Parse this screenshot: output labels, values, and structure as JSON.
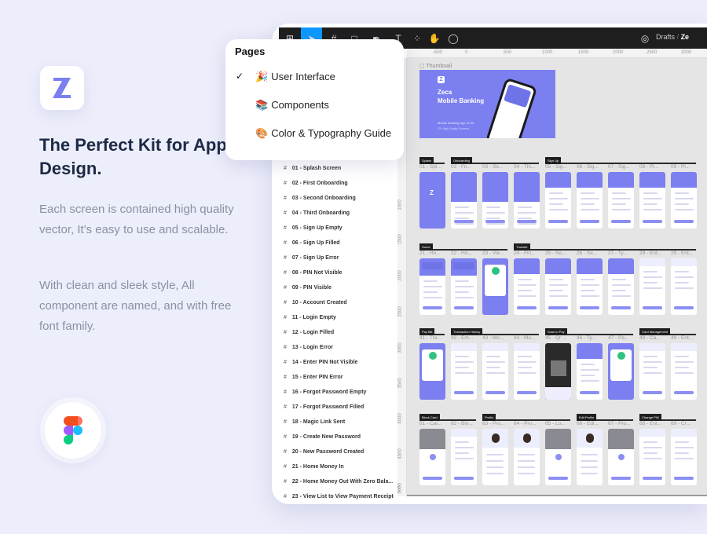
{
  "brand": {
    "accent": "#7b7ff0",
    "logo_letter": "Z"
  },
  "hero": {
    "title": "The Perfect Kit for App Design.",
    "paragraph1": "Each screen is contained high quality vector, It's easy to use and scalable.",
    "paragraph2": "With clean and sleek style, All component are named, and with free font family."
  },
  "toolbar": {
    "breadcrumb_root": "Drafts",
    "breadcrumb_sep": "/",
    "breadcrumb_file": "Ze",
    "active_tool": "move"
  },
  "pages_menu": {
    "title": "Pages",
    "items": [
      {
        "emoji": "🎉",
        "label": "User Interface",
        "selected": true
      },
      {
        "emoji": "📚",
        "label": "Components",
        "selected": false
      },
      {
        "emoji": "🎨",
        "label": "Color & Typography Guide",
        "selected": false
      }
    ]
  },
  "rulers": {
    "horizontal": [
      "-500",
      "0",
      "500",
      "1000",
      "1500",
      "2000",
      "2500",
      "3000"
    ],
    "vertical": [
      "1000",
      "1500",
      "2000",
      "2500",
      "3000",
      "3500",
      "4000",
      "4500",
      "5000",
      "100"
    ]
  },
  "layers": [
    "01 - Splash Screen",
    "02 - First Onboarding",
    "03 - Second Onboarding",
    "04 - Third Onboarding",
    "05 - Sign Up Empty",
    "06 - Sign Up Filled",
    "07 - Sign Up Error",
    "08 - PIN Not Visible",
    "09 - PIN Visible",
    "10 - Account Created",
    "11 - Login Empty",
    "12 - Login Filled",
    "13 - Login Error",
    "14 - Enter PIN Not Visible",
    "15 - Enter PIN Error",
    "16 - Forgot Password Empty",
    "17 - Forgot Password Filled",
    "18 - Magic Link Sent",
    "19 - Create New Password",
    "20 - New Password Created",
    "21 - Home Money In",
    "22 - Home Money Out With Zero Bala...",
    "23 - View List to View Payment Receipt"
  ],
  "thumbnail": {
    "label": "Thumbnail",
    "title_line1": "Zeca",
    "title_line2": "Mobile Banking",
    "subtitle": "Mobile Banking App UI Kit",
    "caption": "70+ High Quality Screens"
  },
  "canvas_rows": [
    {
      "sections": [
        {
          "col": 0,
          "span": 1,
          "label": "Splash"
        },
        {
          "col": 1,
          "span": 3,
          "label": "Onboarding"
        },
        {
          "col": 4,
          "span": 5,
          "label": "Sign Up"
        }
      ],
      "frames": [
        "01 - Spl...",
        "02 - Fir...",
        "03 - Se...",
        "04 - Thi...",
        "05 - Sig...",
        "06 - Sig...",
        "07 - Sig...",
        "08 - Pi...",
        "09 - Pi..."
      ],
      "styles": [
        "splash",
        "onboard",
        "onboard",
        "onboard",
        "header",
        "header",
        "header",
        "header",
        "header"
      ]
    },
    {
      "sections": [
        {
          "col": 0,
          "span": 3,
          "label": "Home"
        },
        {
          "col": 3,
          "span": 6,
          "label": "Transfer"
        }
      ],
      "frames": [
        "21 - Ho...",
        "22 - Ho...",
        "23 - Vie...",
        "24 - Fin...",
        "25 - Se...",
        "26 - Se...",
        "27 - Ty...",
        "28 - Ent...",
        "29 - Ent..."
      ],
      "styles": [
        "home",
        "home",
        "receipt",
        "header",
        "header",
        "header",
        "header",
        "light",
        "light"
      ]
    },
    {
      "sections": [
        {
          "col": 0,
          "span": 1,
          "label": "Pay Bill"
        },
        {
          "col": 1,
          "span": 3,
          "label": "Transaction History"
        },
        {
          "col": 4,
          "span": 3,
          "label": "Scan to Pay"
        },
        {
          "col": 7,
          "span": 2,
          "label": "Card Management"
        }
      ],
      "frames": [
        "41 - Tra...",
        "42 - Em...",
        "43 - Mo...",
        "44 - Mo...",
        "45 - Qr ...",
        "46 - Ty...",
        "47 - Pa...",
        "48 - Ca...",
        "49 - Ent..."
      ],
      "styles": [
        "receipt",
        "light",
        "light",
        "light",
        "dark",
        "header",
        "receipt",
        "light",
        "light"
      ]
    },
    {
      "sections": [
        {
          "col": 0,
          "span": 2,
          "label": "Block Card"
        },
        {
          "col": 2,
          "span": 3,
          "label": "Profile"
        },
        {
          "col": 5,
          "span": 2,
          "label": "Edit Profile"
        },
        {
          "col": 7,
          "span": 2,
          "label": "Change PIN"
        }
      ],
      "frames": [
        "61 - Car...",
        "62 - Blo...",
        "63 - Pro...",
        "64 - Pro...",
        "65 - Lo...",
        "66 - Edi...",
        "67 - Pro...",
        "68 - Ent...",
        "69 - Cr..."
      ],
      "styles": [
        "grey",
        "light",
        "profile",
        "profile",
        "grey",
        "profile",
        "grey",
        "light",
        "light"
      ]
    }
  ]
}
